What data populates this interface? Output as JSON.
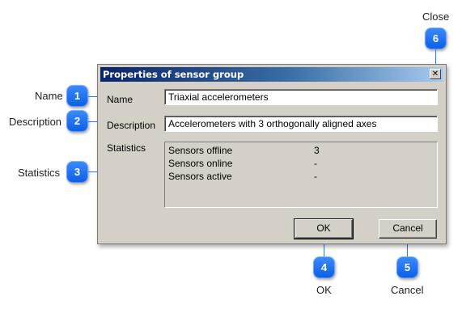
{
  "dialog": {
    "title": "Properties of sensor group",
    "close_glyph": "✕",
    "name_label": "Name",
    "name_value": "Triaxial accelerometers",
    "description_label": "Description",
    "description_value": "Accelerometers with 3 orthogonally aligned axes",
    "statistics_label": "Statistics",
    "statistics": [
      {
        "label": "Sensors offline",
        "value": "3"
      },
      {
        "label": "Sensors online",
        "value": "-"
      },
      {
        "label": "Sensors active",
        "value": "-"
      }
    ],
    "ok_label": "OK",
    "cancel_label": "Cancel"
  },
  "callouts": [
    {
      "number": "1",
      "label": "Name"
    },
    {
      "number": "2",
      "label": "Description"
    },
    {
      "number": "3",
      "label": "Statistics"
    },
    {
      "number": "4",
      "label": "OK"
    },
    {
      "number": "5",
      "label": "Cancel"
    },
    {
      "number": "6",
      "label": "Close"
    }
  ],
  "colors": {
    "badge": "#1a6ff0",
    "titlebar_start": "#0a246a",
    "titlebar_end": "#a6caf0",
    "dialog_face": "#d4d0c8"
  }
}
